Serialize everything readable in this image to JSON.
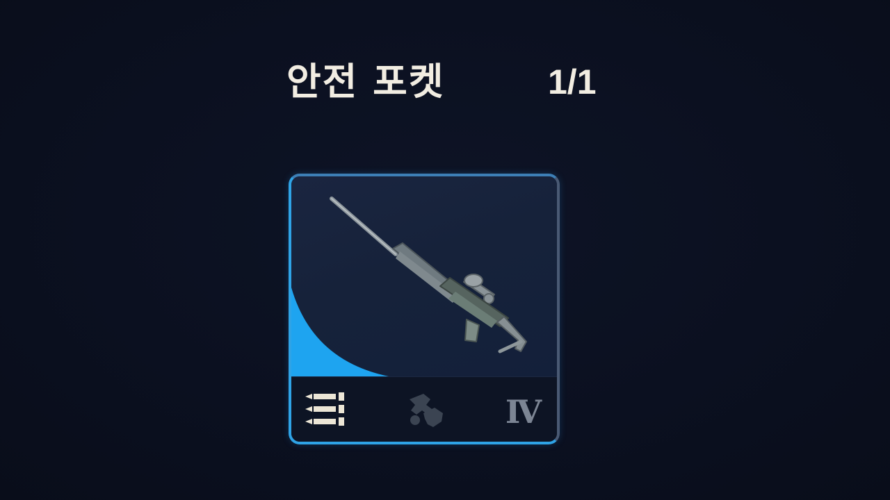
{
  "pocket": {
    "title": "안전 포켓",
    "count": "1/1"
  },
  "item": {
    "name_icon": "sniper-rifle-icon",
    "rarity_color": "#1ea4f0",
    "footer": {
      "ammo_icon": "ammo-magazine-icon",
      "attachment_icon": "attachment-parts-icon",
      "tier": "Ⅳ"
    }
  },
  "colors": {
    "background": "#0c1120",
    "slot_border": "#2fa3e6",
    "text": "#f2ede2"
  }
}
